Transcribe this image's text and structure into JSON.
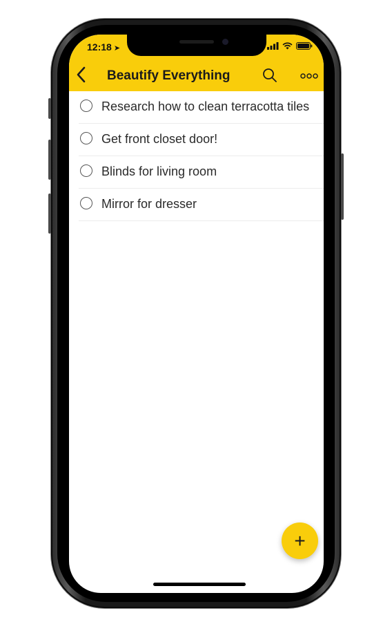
{
  "status_bar": {
    "time": "12:18",
    "location_arrow": "➤"
  },
  "nav": {
    "title": "Beautify Everything",
    "back_icon": "chevron-left-icon",
    "search_icon": "search-icon",
    "more_icon": "more-horizontal-icon"
  },
  "list": {
    "items": [
      {
        "label": "Research how to clean terracotta tiles",
        "completed": false
      },
      {
        "label": "Get front closet door!",
        "completed": false
      },
      {
        "label": "Blinds for living room",
        "completed": false
      },
      {
        "label": "Mirror for dresser",
        "completed": false
      }
    ]
  },
  "fab": {
    "label": "+"
  },
  "colors": {
    "accent": "#f9cd0b",
    "text": "#2a2a2a",
    "divider": "#ececec"
  }
}
